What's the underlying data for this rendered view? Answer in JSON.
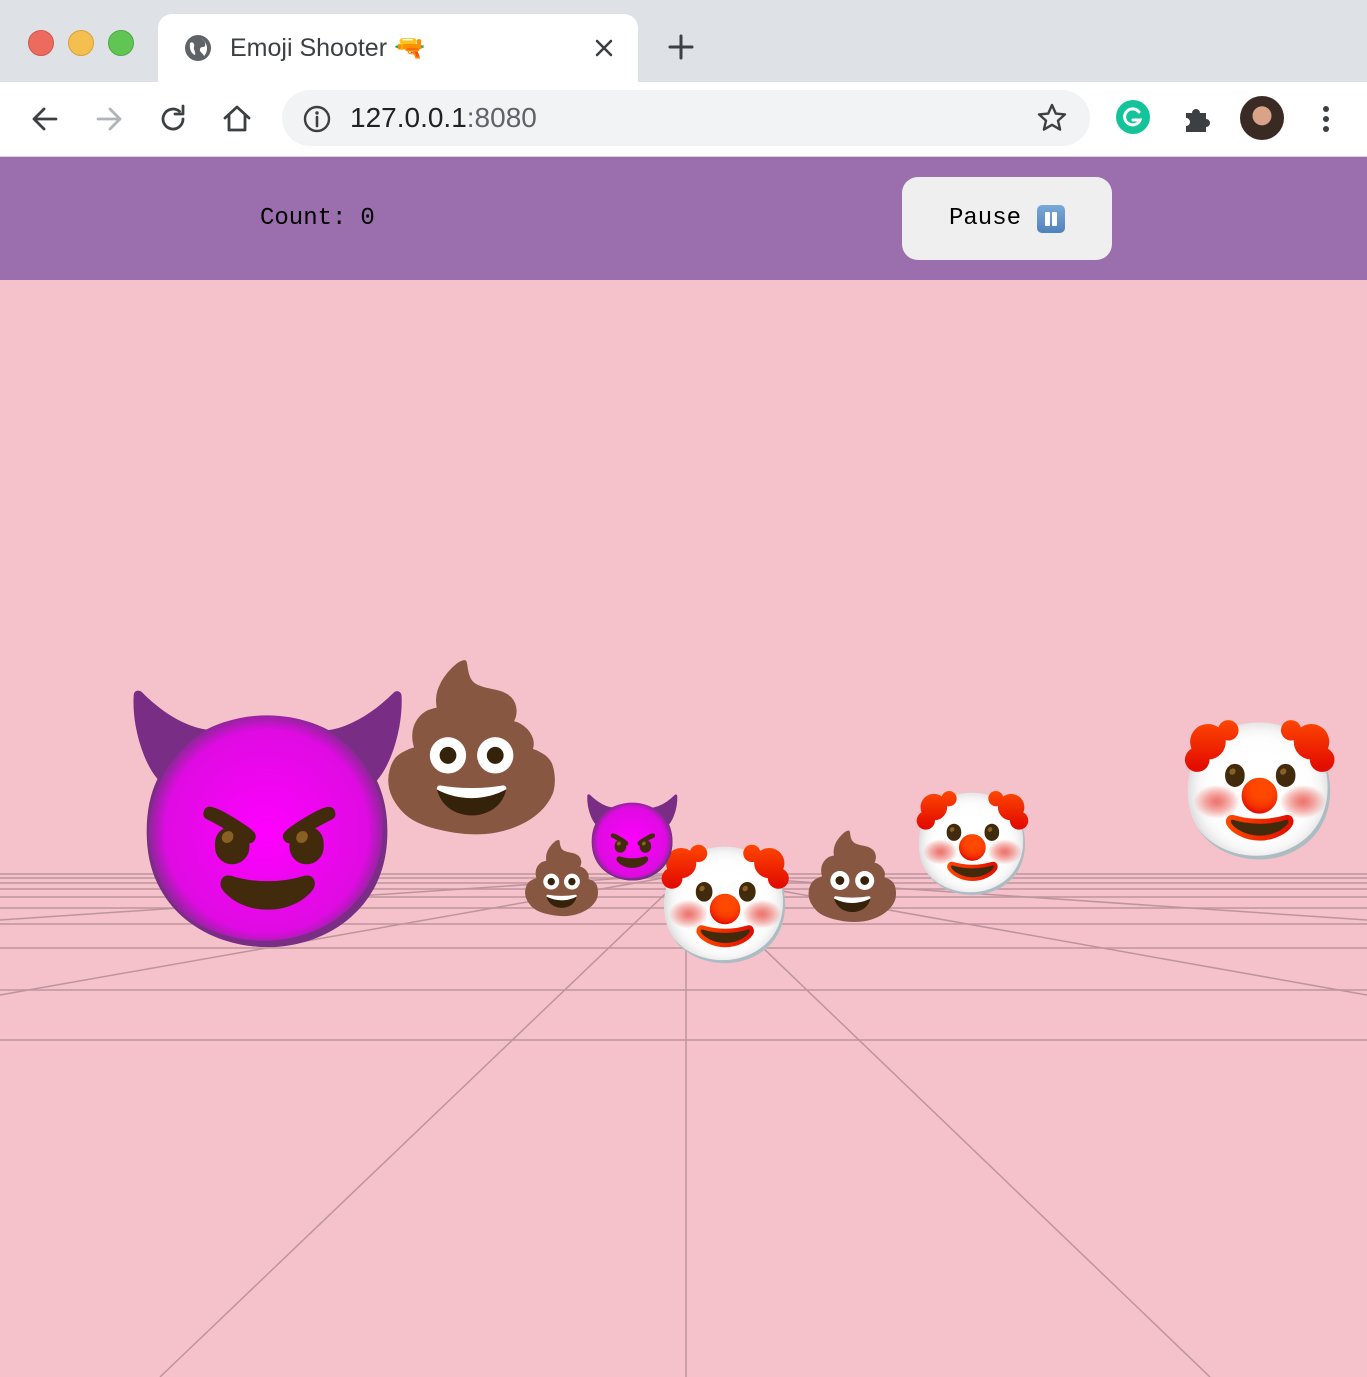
{
  "browser": {
    "tab": {
      "title": "Emoji Shooter 🔫"
    },
    "address": {
      "host": "127.0.0.1",
      "port": ":8080"
    }
  },
  "game": {
    "count_label": "Count:",
    "count_value": "0",
    "pause_label": "Pause",
    "pause_icon": "pause-button-icon",
    "background_color": "#f5c1ca",
    "header_color": "#9b6fad",
    "targets": [
      {
        "kind": "smiling-devil",
        "emoji": "😈"
      },
      {
        "kind": "poop",
        "emoji": "💩"
      },
      {
        "kind": "poop",
        "emoji": "💩"
      },
      {
        "kind": "smiling-devil",
        "emoji": "😈"
      },
      {
        "kind": "clown",
        "emoji": "🤡"
      },
      {
        "kind": "poop",
        "emoji": "💩"
      },
      {
        "kind": "clown",
        "emoji": "🤡"
      },
      {
        "kind": "clown",
        "emoji": "🤡"
      }
    ]
  }
}
